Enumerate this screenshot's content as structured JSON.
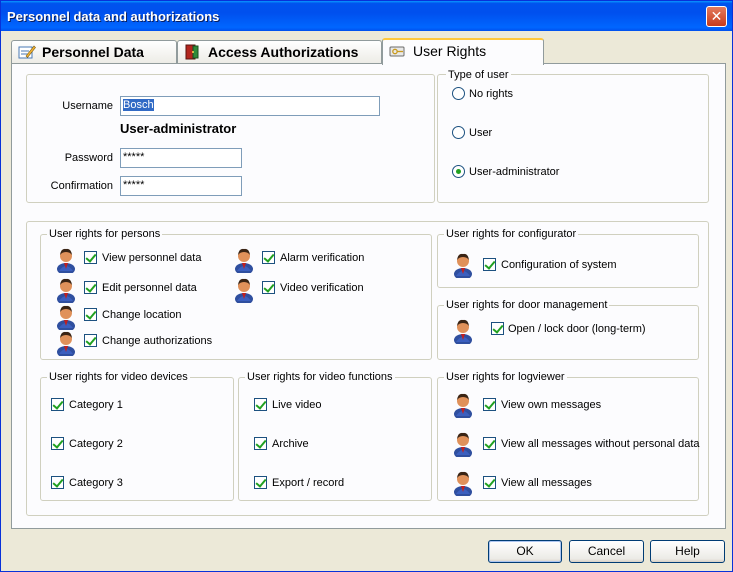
{
  "window": {
    "title": "Personnel data and authorizations",
    "close_label": "✕"
  },
  "tabs": [
    {
      "label": "Personnel Data",
      "icon": "pencil-icon"
    },
    {
      "label": "Access Authorizations",
      "icon": "door-icon"
    },
    {
      "label": "User Rights",
      "icon": "key-icon"
    }
  ],
  "login": {
    "username_label": "Username",
    "username_value": "Bosch",
    "role_text": "User-administrator",
    "password_label": "Password",
    "password_value": "*****",
    "confirmation_label": "Confirmation",
    "confirmation_value": "*****"
  },
  "user_type": {
    "title": "Type of user",
    "options": [
      "No rights",
      "User",
      "User-administrator"
    ],
    "selected": "User-administrator"
  },
  "persons_rights": {
    "title": "User rights for persons",
    "items": [
      "View personnel data",
      "Edit personnel data",
      "Change location",
      "Change authorizations",
      "Alarm verification",
      "Video verification"
    ]
  },
  "configurator_rights": {
    "title": "User rights for configurator",
    "items": [
      "Configuration of system"
    ]
  },
  "door_rights": {
    "title": "User rights for door management",
    "items": [
      "Open / lock door (long-term)"
    ]
  },
  "video_devices_rights": {
    "title": "User rights for video devices",
    "items": [
      "Category 1",
      "Category 2",
      "Category 3"
    ]
  },
  "video_functions_rights": {
    "title": "User rights for video functions",
    "items": [
      "Live video",
      "Archive",
      "Export / record"
    ]
  },
  "logviewer_rights": {
    "title": "User rights for logviewer",
    "items": [
      "View own messages",
      "View all messages without personal data",
      "View all messages"
    ]
  },
  "buttons": {
    "ok": "OK",
    "cancel": "Cancel",
    "help": "Help"
  },
  "colors": {
    "title_bar": "#0053ee",
    "check": "#21a121",
    "selection": "#316ac5"
  }
}
